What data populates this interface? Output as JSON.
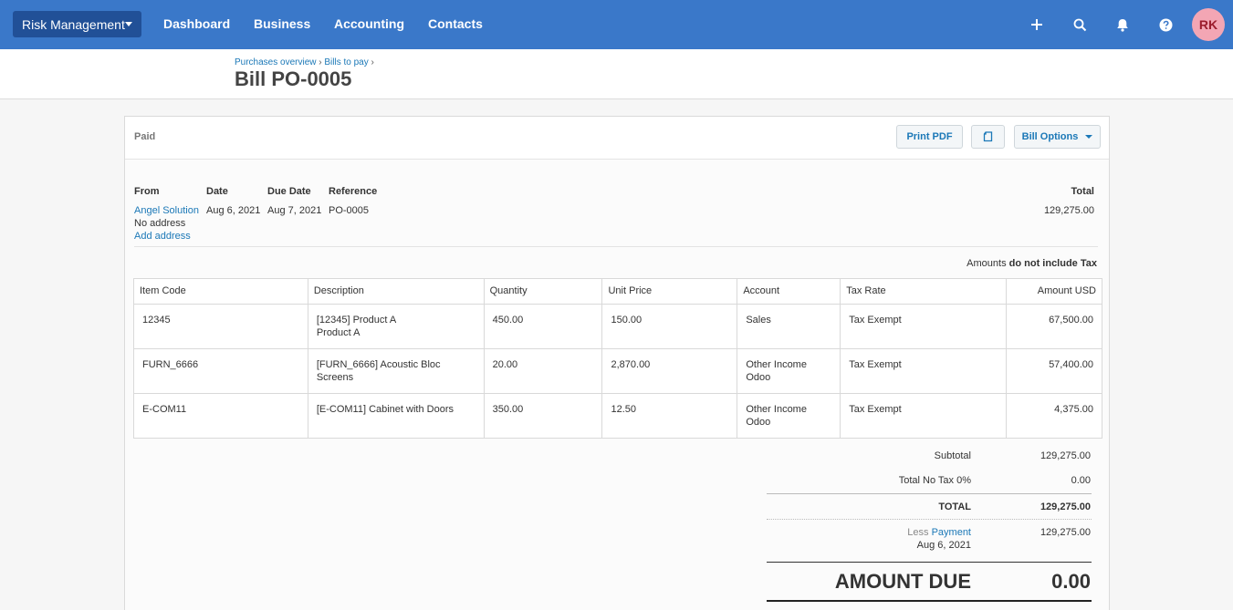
{
  "topbar": {
    "org": "Risk Management",
    "nav": [
      "Dashboard",
      "Business",
      "Accounting",
      "Contacts"
    ],
    "avatar": "RK",
    "icons": [
      "plus-icon",
      "search-icon",
      "bell-icon",
      "help-icon"
    ]
  },
  "header": {
    "breadcrumb": [
      "Purchases overview",
      "Bills to pay"
    ],
    "separator": "›",
    "title": "Bill PO-0005"
  },
  "bill": {
    "status": "Paid",
    "buttons": {
      "print": "Print PDF",
      "options": "Bill Options"
    },
    "labels": {
      "from": "From",
      "date": "Date",
      "due_date": "Due Date",
      "reference": "Reference",
      "total": "Total"
    },
    "from": {
      "name": "Angel Solution",
      "address": "No address",
      "add_address": "Add address"
    },
    "date": "Aug 6, 2021",
    "due_date": "Aug 7, 2021",
    "reference": "PO-0005",
    "total": "129,275.00",
    "tax_note": {
      "prefix": "Amounts",
      "strong": "do not include Tax"
    }
  },
  "table": {
    "headers": [
      "Item Code",
      "Description",
      "Quantity",
      "Unit Price",
      "Account",
      "Tax Rate",
      "Amount USD"
    ],
    "rows": [
      {
        "code": "12345",
        "desc1": "[12345] Product A",
        "desc2": "Product A",
        "qty": "450.00",
        "price": "150.00",
        "acc1": "Sales",
        "acc2": "",
        "tax": "Tax Exempt",
        "amount": "67,500.00"
      },
      {
        "code": "FURN_6666",
        "desc1": "[FURN_6666] Acoustic Bloc",
        "desc2": "Screens",
        "qty": "20.00",
        "price": "2,870.00",
        "acc1": "Other Income",
        "acc2": "Odoo",
        "tax": "Tax Exempt",
        "amount": "57,400.00"
      },
      {
        "code": "E-COM11",
        "desc1": "[E-COM11] Cabinet with Doors",
        "desc2": "",
        "qty": "350.00",
        "price": "12.50",
        "acc1": "Other Income",
        "acc2": "Odoo",
        "tax": "Tax Exempt",
        "amount": "4,375.00"
      }
    ]
  },
  "totals": {
    "subtotal_label": "Subtotal",
    "subtotal": "129,275.00",
    "tax_label": "Total No Tax 0%",
    "tax": "0.00",
    "total_label": "TOTAL",
    "total": "129,275.00",
    "less": "Less",
    "payment_label": "Payment",
    "payment_date": "Aug 6, 2021",
    "payment": "129,275.00",
    "due_label": "AMOUNT DUE",
    "due": "0.00"
  }
}
